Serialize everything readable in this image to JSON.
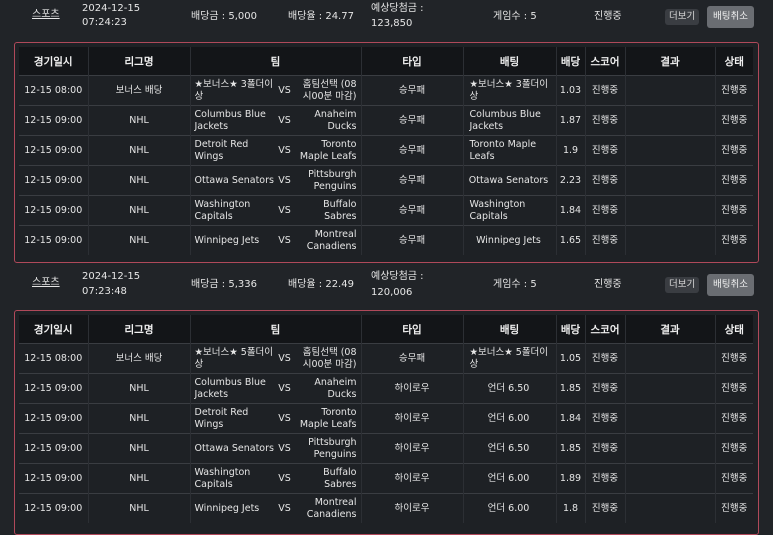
{
  "slips": [
    {
      "sport": "스포츠",
      "date": "2024-12-15",
      "time": "07:24:23",
      "bet_amount": "배당금 : 5,000",
      "odds": "배당율 : 24.77",
      "expected_label": "예상당첨금 :",
      "expected_value": "123,850",
      "games": "게임수 : 5",
      "status": "진행중",
      "more": "더보기",
      "cancel": "배팅취소",
      "rows": [
        {
          "time": "12-15 08:00",
          "league": "보너스 배당",
          "home": "★보너스★ 3폴더이상",
          "vs": "VS",
          "away": "홈팀선택 (08시00분 마감)",
          "type": "승무패",
          "pick": "★보너스★ 3폴더이상",
          "odd": "1.03",
          "score": "진행중",
          "result": "",
          "state": "진행중"
        },
        {
          "time": "12-15 09:00",
          "league": "NHL",
          "home": "Columbus Blue Jackets",
          "vs": "VS",
          "away": "Anaheim Ducks",
          "type": "승무패",
          "pick": "Columbus Blue Jackets",
          "odd": "1.87",
          "score": "진행중",
          "result": "",
          "state": "진행중"
        },
        {
          "time": "12-15 09:00",
          "league": "NHL",
          "home": "Detroit Red Wings",
          "vs": "VS",
          "away": "Toronto Maple Leafs",
          "type": "승무패",
          "pick": "Toronto Maple Leafs",
          "odd": "1.9",
          "score": "진행중",
          "result": "",
          "state": "진행중"
        },
        {
          "time": "12-15 09:00",
          "league": "NHL",
          "home": "Ottawa Senators",
          "vs": "VS",
          "away": "Pittsburgh Penguins",
          "type": "승무패",
          "pick": "Ottawa Senators",
          "odd": "2.23",
          "score": "진행중",
          "result": "",
          "state": "진행중"
        },
        {
          "time": "12-15 09:00",
          "league": "NHL",
          "home": "Washington Capitals",
          "vs": "VS",
          "away": "Buffalo Sabres",
          "type": "승무패",
          "pick": "Washington Capitals",
          "odd": "1.84",
          "score": "진행중",
          "result": "",
          "state": "진행중"
        },
        {
          "time": "12-15 09:00",
          "league": "NHL",
          "home": "Winnipeg Jets",
          "vs": "VS",
          "away": "Montreal Canadiens",
          "type": "승무패",
          "pick": "Winnipeg Jets",
          "odd": "1.65",
          "score": "진행중",
          "result": "",
          "state": "진행중"
        }
      ]
    },
    {
      "sport": "스포츠",
      "date": "2024-12-15",
      "time": "07:23:48",
      "bet_amount": "배당금 : 5,336",
      "odds": "배당율 : 22.49",
      "expected_label": "예상당첨금 :",
      "expected_value": "120,006",
      "games": "게임수 : 5",
      "status": "진행중",
      "more": "더보기",
      "cancel": "배팅취소",
      "rows": [
        {
          "time": "12-15 08:00",
          "league": "보너스 배당",
          "home": "★보너스★ 5폴더이상",
          "vs": "VS",
          "away": "홈팀선택 (08시00분 마감)",
          "type": "승무패",
          "pick": "★보너스★ 5폴더이상",
          "odd": "1.05",
          "score": "진행중",
          "result": "",
          "state": "진행중"
        },
        {
          "time": "12-15 09:00",
          "league": "NHL",
          "home": "Columbus Blue Jackets",
          "vs": "VS",
          "away": "Anaheim Ducks",
          "type": "하이로우",
          "pick": "언더 6.50",
          "odd": "1.85",
          "score": "진행중",
          "result": "",
          "state": "진행중"
        },
        {
          "time": "12-15 09:00",
          "league": "NHL",
          "home": "Detroit Red Wings",
          "vs": "VS",
          "away": "Toronto Maple Leafs",
          "type": "하이로우",
          "pick": "언더 6.00",
          "odd": "1.84",
          "score": "진행중",
          "result": "",
          "state": "진행중"
        },
        {
          "time": "12-15 09:00",
          "league": "NHL",
          "home": "Ottawa Senators",
          "vs": "VS",
          "away": "Pittsburgh Penguins",
          "type": "하이로우",
          "pick": "언더 6.50",
          "odd": "1.85",
          "score": "진행중",
          "result": "",
          "state": "진행중"
        },
        {
          "time": "12-15 09:00",
          "league": "NHL",
          "home": "Washington Capitals",
          "vs": "VS",
          "away": "Buffalo Sabres",
          "type": "하이로우",
          "pick": "언더 6.00",
          "odd": "1.89",
          "score": "진행중",
          "result": "",
          "state": "진행중"
        },
        {
          "time": "12-15 09:00",
          "league": "NHL",
          "home": "Winnipeg Jets",
          "vs": "VS",
          "away": "Montreal Canadiens",
          "type": "하이로우",
          "pick": "언더 6.00",
          "odd": "1.8",
          "score": "진행중",
          "result": "",
          "state": "진행중"
        }
      ]
    }
  ],
  "columns": [
    "경기일시",
    "리그명",
    "팀",
    "타입",
    "배팅",
    "배당",
    "스코어",
    "결과",
    "상태"
  ]
}
